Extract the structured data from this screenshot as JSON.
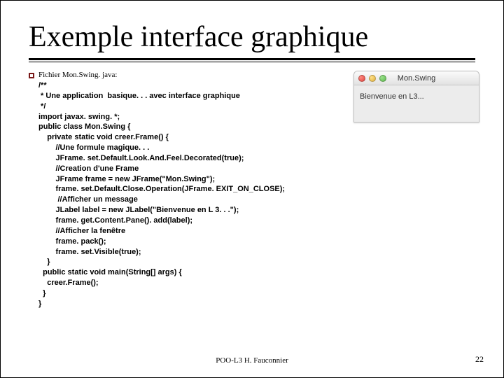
{
  "title": "Exemple interface graphique",
  "file_header": "Fichier Mon.Swing. java:",
  "code_lines": [
    "/**",
    " * Une application  basique. . . avec interface graphique",
    " */",
    "import javax. swing. *;",
    "public class Mon.Swing {",
    "    private static void creer.Frame() {",
    "        //Une formule magique. . .",
    "        JFrame. set.Default.Look.And.Feel.Decorated(true);",
    "        //Creation d'une Frame",
    "        JFrame frame = new JFrame(\"Mon.Swing\");",
    "        frame. set.Default.Close.Operation(JFrame. EXIT_ON_CLOSE);",
    "         //Afficher un message",
    "        JLabel label = new JLabel(\"Bienvenue en L 3. . .\");",
    "        frame. get.Content.Pane(). add(label);",
    "        //Afficher la fenêtre",
    "        frame. pack();",
    "        frame. set.Visible(true);",
    "    }",
    "  public static void main(String[] args) {",
    "    creer.Frame();",
    "  }",
    "}"
  ],
  "window": {
    "title": "Mon.Swing",
    "body": "Bienvenue en L3..."
  },
  "footer": "POO-L3 H. Fauconnier",
  "page": "22"
}
